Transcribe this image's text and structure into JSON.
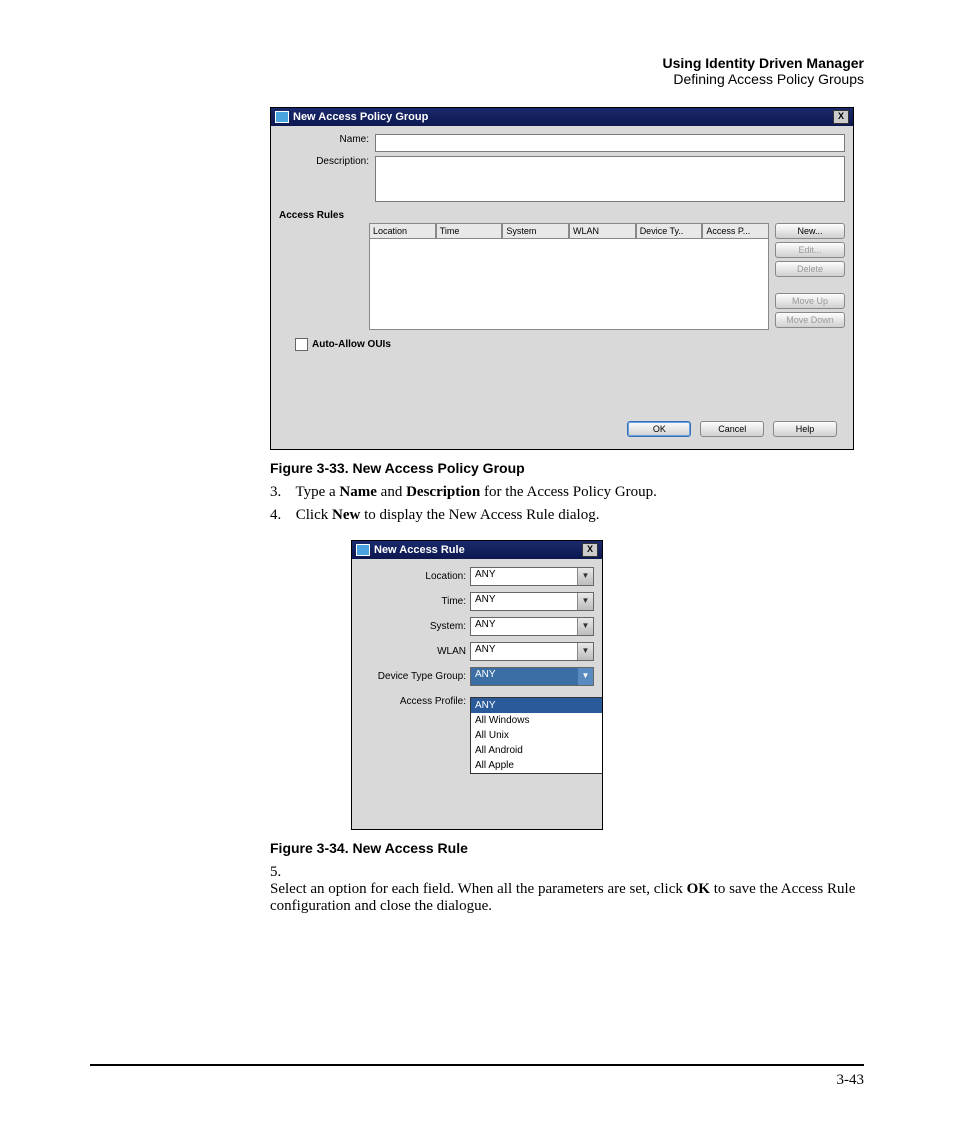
{
  "header": {
    "bold": "Using Identity Driven Manager",
    "light": "Defining Access Policy Groups"
  },
  "dialog1": {
    "title": "New Access Policy Group",
    "close": "X",
    "name_label": "Name:",
    "desc_label": "Description:",
    "rules_label": "Access Rules",
    "columns": [
      "Location",
      "Time",
      "System",
      "WLAN",
      "Device Ty..",
      "Access P..."
    ],
    "buttons": {
      "new": "New...",
      "edit": "Edit...",
      "delete": "Delete",
      "moveup": "Move Up",
      "movedown": "Move Down"
    },
    "checkbox": "Auto-Allow OUIs",
    "ok": "OK",
    "cancel": "Cancel",
    "help": "Help"
  },
  "fig33": "Figure 3-33. New Access Policy Group",
  "step3_pre": "Type a ",
  "step3_name": "Name",
  "step3_and": " and ",
  "step3_desc": "Description",
  "step3_post": " for the Access Policy Group.",
  "step4_pre": "Click ",
  "step4_new": "New",
  "step4_post": " to display the New Access Rule dialog.",
  "dialog2": {
    "title": "New Access Rule",
    "close": "X",
    "fields": {
      "location": {
        "label": "Location:",
        "value": "ANY"
      },
      "time": {
        "label": "Time:",
        "value": "ANY"
      },
      "system": {
        "label": "System:",
        "value": "ANY"
      },
      "wlan": {
        "label": "WLAN",
        "value": "ANY"
      },
      "devtype": {
        "label": "Device Type Group:",
        "value": "ANY"
      },
      "profile": {
        "label": "Access Profile:",
        "value": ""
      }
    },
    "dropdown": [
      "ANY",
      "All Windows",
      "All Unix",
      "All Android",
      "All Apple"
    ]
  },
  "fig34": "Figure 3-34. New Access Rule",
  "step5_pre": "Select an option for each field. When all the parameters are set, click ",
  "step5_ok": "OK",
  "step5_post": " to save the Access Rule configuration and close the dialogue.",
  "page_number": "3-43"
}
